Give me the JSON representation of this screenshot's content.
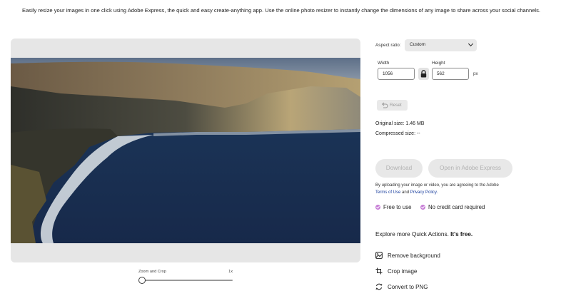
{
  "intro": {
    "text": "Easily resize your images in one click using Adobe Express, the quick and easy create-anything app. Use the online photo resizer to instantly change the dimensions of any image to share across your social channels."
  },
  "zoom": {
    "label": "Zoom and Crop",
    "value": "1x",
    "level": 0
  },
  "controls": {
    "aspect_label": "Aspect ratio:",
    "aspect_value": "Custom",
    "width_label": "Width",
    "height_label": "Height",
    "width_value": "1056",
    "height_value": "562",
    "unit": "px",
    "reset_label": "Reset",
    "original_size": "Original size:  1.46 MB",
    "compressed_size": "Compressed size:  --"
  },
  "actions": {
    "download": "Download",
    "open": "Open in Adobe Express"
  },
  "terms": {
    "prefix": "By uploading your image or video, you are agreeing to the Adobe",
    "terms_link": "Terms of Use",
    "and": "and",
    "privacy_link": "Privacy Policy."
  },
  "features": {
    "free": "Free to use",
    "no_card": "No credit card required",
    "check_color": "#c77ed6"
  },
  "explore": {
    "lead": "Explore more Quick Actions.",
    "emph": "It's free."
  },
  "quick_actions": [
    {
      "label": "Remove background",
      "icon": "remove-background-icon"
    },
    {
      "label": "Crop image",
      "icon": "crop-icon"
    },
    {
      "label": "Convert to PNG",
      "icon": "convert-icon"
    }
  ]
}
